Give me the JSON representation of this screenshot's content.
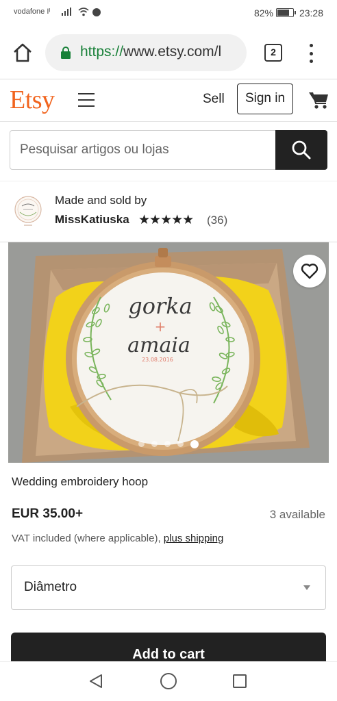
{
  "status_bar": {
    "carrier": "vodafone Iᴵ",
    "battery_percent": "82%",
    "battery_level": 0.82,
    "time": "23:28"
  },
  "browser": {
    "url_protocol": "https://",
    "url_rest": "www.etsy.com/l",
    "tab_count": "2"
  },
  "header": {
    "logo": "Etsy",
    "sell_label": "Sell",
    "sign_in_label": "Sign in"
  },
  "search": {
    "placeholder": "Pesquisar artigos ou lojas"
  },
  "shop": {
    "made_by_label": "Made and sold by",
    "name": "MissKatiuska",
    "stars": "★★★★★",
    "rating": 5,
    "review_count": "(36)"
  },
  "product_image": {
    "hoop_text_1": "gorka",
    "hoop_text_plus": "+",
    "hoop_text_2": "amaia",
    "hoop_date": "23.08.2016",
    "image_count": 5,
    "active_image": 5
  },
  "listing": {
    "title": "Wedding embroidery hoop",
    "price": "EUR 35.00+",
    "availability": "3 available",
    "vat_text": "VAT included (where applicable), ",
    "shipping_link": "plus shipping",
    "variation_label": "Diâmetro",
    "add_to_cart_label": "Add to cart"
  },
  "colors": {
    "etsy_orange": "#f1641e",
    "dark": "#222222",
    "url_green": "#188038"
  }
}
